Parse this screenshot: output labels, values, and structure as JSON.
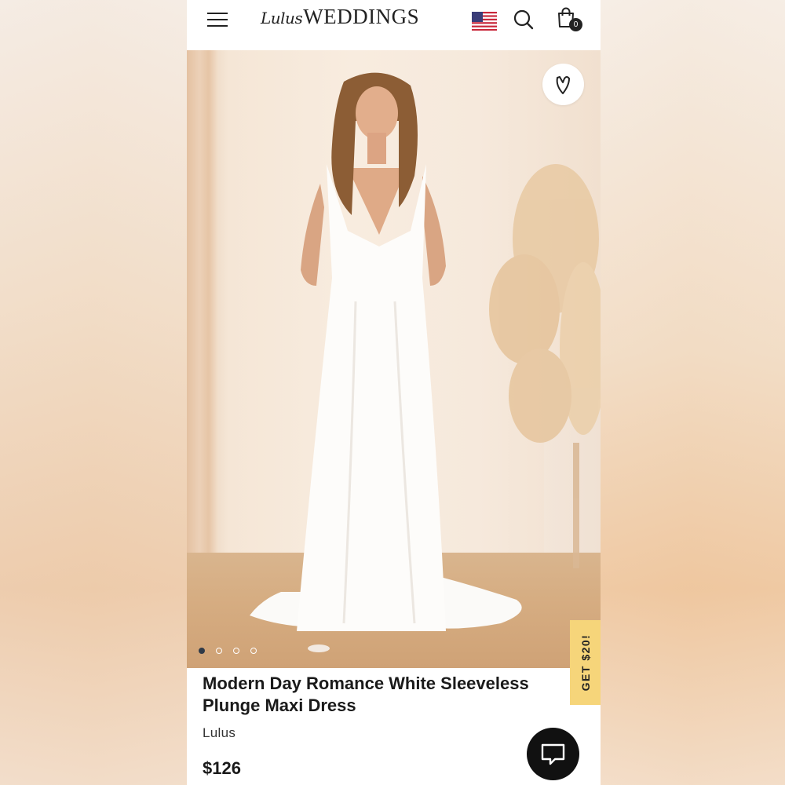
{
  "header": {
    "logo_script": "Lulus",
    "logo_main": "WEDDINGS",
    "cart_count": "0",
    "icons": [
      "menu-icon",
      "us-flag-icon",
      "search-icon",
      "shopping-bag-icon"
    ]
  },
  "hero": {
    "image_description": "model-in-white-maxi-dress",
    "carousel_total": 4,
    "carousel_active_index": 0,
    "wishlist_icon": "heart-v-icon"
  },
  "promo": {
    "label": "GET $20!"
  },
  "product": {
    "title": "Modern Day Romance White Sleeveless Plunge Maxi Dress",
    "brand": "Lulus",
    "price": "$126"
  },
  "chat": {
    "icon": "chat-bubble-icon"
  },
  "colors": {
    "promo_bg": "#f6d57a",
    "text": "#1a1a1a",
    "carousel_active": "#2f3a48",
    "chat_bg": "#111111"
  }
}
